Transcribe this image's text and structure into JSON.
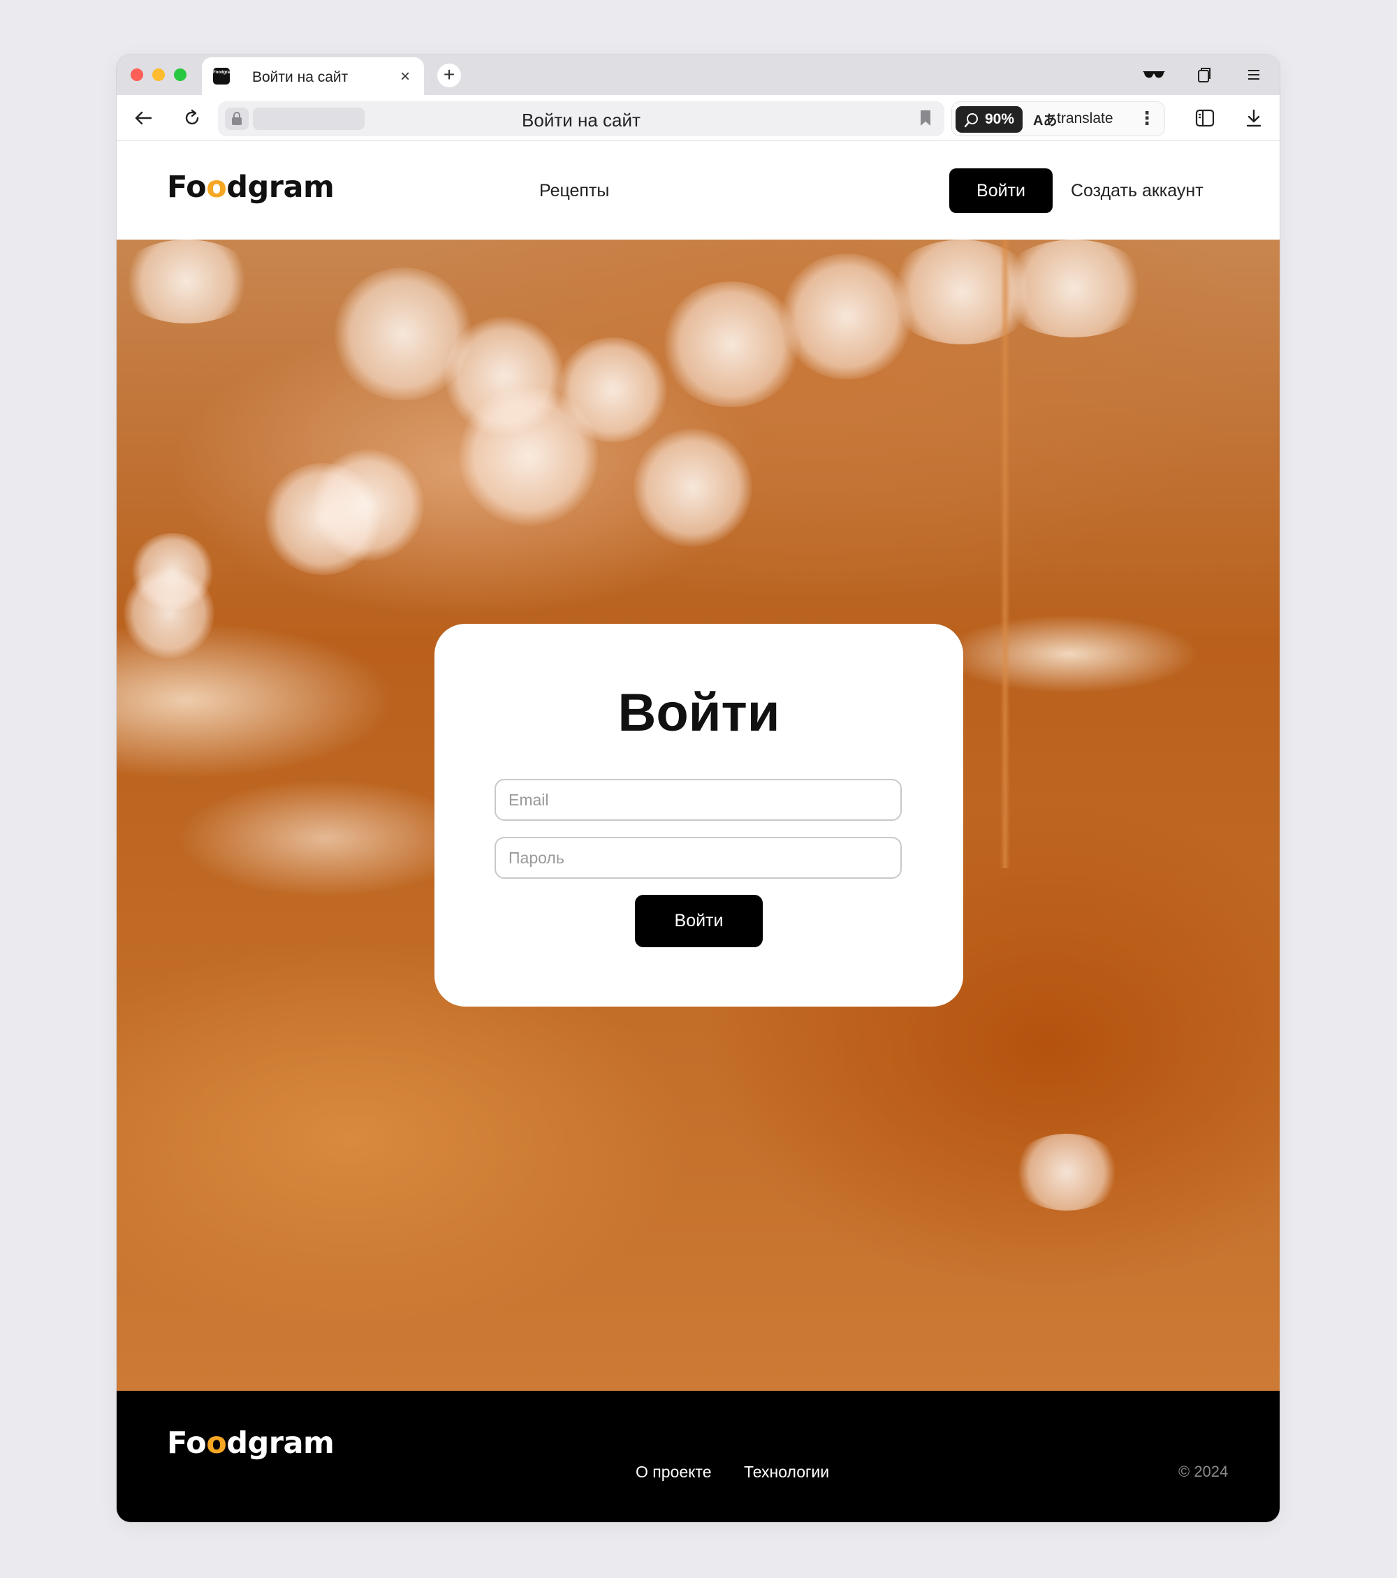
{
  "browser": {
    "tab_title": "Войти на сайт",
    "tab_favicon_text": "Foodgram",
    "tab_close_glyph": "×",
    "new_tab_glyph": "+",
    "url_display": "Войти на сайт",
    "zoom_level": "90%",
    "translate_label": "translate",
    "translate_glyph": "Aあ",
    "more_glyph": "⋮"
  },
  "header": {
    "logo_pre": "Fo",
    "logo_mark": "o",
    "logo_post": "dgram",
    "nav_recipes": "Рецепты",
    "login_button": "Войти",
    "signup_link": "Создать аккаунт"
  },
  "login_card": {
    "title": "Войти",
    "email_placeholder": "Email",
    "password_placeholder": "Пароль",
    "submit_button": "Войти"
  },
  "footer": {
    "logo_pre": "Fo",
    "logo_mark": "o",
    "logo_post": "dgram",
    "links": [
      "О проекте",
      "Технологии"
    ],
    "copyright": "© 2024"
  },
  "colors": {
    "accent": "#f5a623",
    "primary_button": "#000000",
    "footer_bg": "#000000",
    "page_bg": "#ebebef"
  },
  "icons": {
    "back": "arrow-left-icon",
    "reload": "reload-icon",
    "lock": "lock-icon",
    "bookmark": "bookmark-icon",
    "search_zoom": "search-icon",
    "reader": "glasses-icon",
    "tabs": "tabs-icon",
    "menu": "menu-icon",
    "sidebar": "sidebar-icon",
    "download": "download-icon"
  }
}
